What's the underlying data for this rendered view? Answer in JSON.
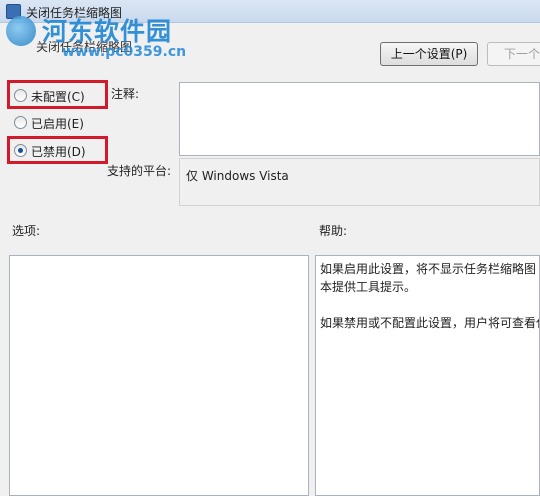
{
  "window": {
    "title": "关闭任务栏缩略图",
    "subtitle": "关闭任务栏缩略图"
  },
  "watermark": {
    "name": "河东软件园",
    "url": "www.pc0359.cn"
  },
  "nav": {
    "prev_label": "上一个设置(P)",
    "next_label": "下一个"
  },
  "options": [
    {
      "label": "未配置(C)",
      "checked": false,
      "highlighted": true
    },
    {
      "label": "已启用(E)",
      "checked": false,
      "highlighted": false
    },
    {
      "label": "已禁用(D)",
      "checked": true,
      "highlighted": true
    }
  ],
  "comment": {
    "label": "注释:",
    "value": ""
  },
  "platform": {
    "label": "支持的平台:",
    "value": "仅 Windows Vista"
  },
  "sections": {
    "options_label": "选项:",
    "help_label": "帮助:"
  },
  "help": {
    "lines": [
      "如果启用此设置，将不显示任务栏缩略图",
      "本提供工具提示。",
      "如果禁用或不配置此设置，用户将可查看代"
    ]
  },
  "colors": {
    "highlight": "#d11a2a",
    "watermark": "#1f86d4"
  }
}
